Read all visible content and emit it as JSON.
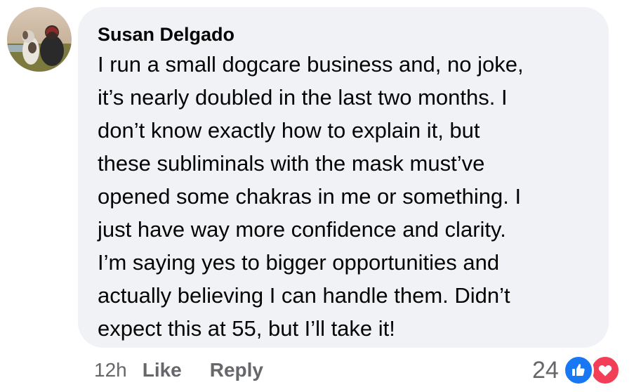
{
  "comment": {
    "author": "Susan Delgado",
    "text_lines": [
      "I run a small dogcare business and, no joke,",
      "it’s nearly doubled in the last two months. I",
      "don’t know exactly how to explain it, but",
      "these subliminals with the mask must’ve",
      "opened some chakras in me or something. I",
      "just have way more confidence and clarity.",
      "I’m saying yes to bigger opportunities and",
      "actually believing I can handle them. Didn’t",
      "expect this at 55, but I’ll take it!"
    ],
    "timestamp": "12h",
    "like_label": "Like",
    "reply_label": "Reply",
    "reaction_count": "24",
    "reactions": [
      "like-icon",
      "love-icon"
    ]
  },
  "colors": {
    "bubble_bg": "#f0f2f5",
    "text": "#050505",
    "secondary_text": "#65676b",
    "like_blue": "#1877f2",
    "love_red": "#f33e58"
  }
}
